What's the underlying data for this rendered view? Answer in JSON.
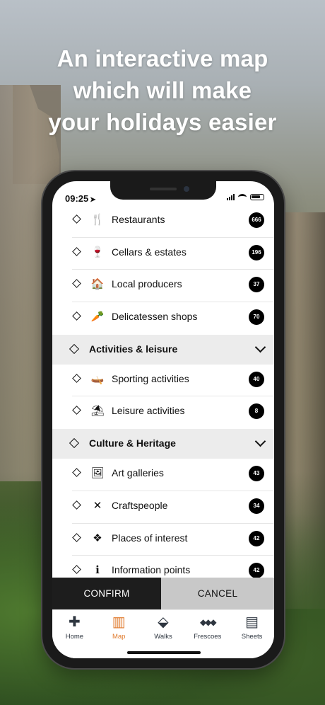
{
  "headline": {
    "line1": "An interactive map",
    "line2": "which will make",
    "line3": "your holidays easier"
  },
  "status_bar": {
    "time": "09:25"
  },
  "list": {
    "rows_a": [
      {
        "label": "Restaurants",
        "icon": "fork-knife-icon",
        "glyph": "🍴",
        "count": "666"
      },
      {
        "label": "Cellars & estates",
        "icon": "wine-bottle-icon",
        "glyph": "🍷",
        "count": "196"
      },
      {
        "label": "Local producers",
        "icon": "shop-icon",
        "glyph": "🏠",
        "count": "37"
      },
      {
        "label": "Delicatessen shops",
        "icon": "carrot-icon",
        "glyph": "🥕",
        "count": "70"
      }
    ],
    "section_activities": "Activities & leisure",
    "rows_b": [
      {
        "label": "Sporting activities",
        "icon": "canoe-icon",
        "glyph": "🛶",
        "count": "40"
      },
      {
        "label": "Leisure activities",
        "icon": "parasol-icon",
        "glyph": "⛱",
        "count": "8"
      }
    ],
    "section_culture": "Culture & Heritage",
    "rows_c": [
      {
        "label": "Art galleries",
        "icon": "frame-icon",
        "glyph": "🖼",
        "count": "43"
      },
      {
        "label": "Craftspeople",
        "icon": "crossed-tools-icon",
        "glyph": "✕",
        "count": "34"
      },
      {
        "label": "Places of interest",
        "icon": "place-pin-icon",
        "glyph": "❖",
        "count": "42"
      },
      {
        "label": "Information points",
        "icon": "info-icon",
        "glyph": "ℹ",
        "count": "42"
      }
    ]
  },
  "actions": {
    "confirm": "CONFIRM",
    "cancel": "CANCEL"
  },
  "tabs": [
    {
      "label": "Home",
      "icon": "cross-icon",
      "glyph": "✚"
    },
    {
      "label": "Map",
      "icon": "map-icon",
      "glyph": "▥"
    },
    {
      "label": "Walks",
      "icon": "walks-icon",
      "glyph": "⬙"
    },
    {
      "label": "Frescoes",
      "icon": "frescoes-icon",
      "glyph": "◆◆◆"
    },
    {
      "label": "Sheets",
      "icon": "sheets-icon",
      "glyph": "▤"
    }
  ],
  "colors": {
    "accent": "#e07a2c",
    "confirm_bg": "#1d1d1d",
    "cancel_bg": "#c8c8c8",
    "section_bg": "#ececec"
  }
}
